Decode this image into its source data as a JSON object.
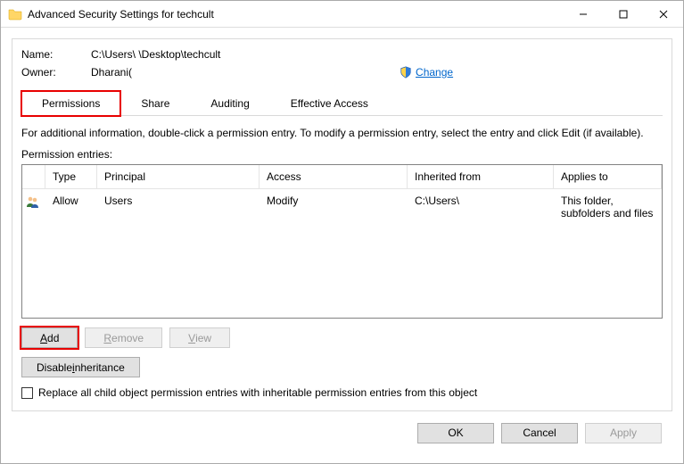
{
  "titlebar": {
    "title": "Advanced Security Settings for techcult"
  },
  "info": {
    "name_label": "Name:",
    "name_value": "C:\\Users\\                              \\Desktop\\techcult",
    "owner_label": "Owner:",
    "owner_value": "Dharani(",
    "change_label": "Change"
  },
  "tabs": {
    "permissions": "Permissions",
    "share": "Share",
    "auditing": "Auditing",
    "effective": "Effective Access"
  },
  "description": "For additional information, double-click a permission entry. To modify a permission entry, select the entry and click Edit (if available).",
  "subhead": "Permission entries:",
  "columns": {
    "type": "Type",
    "principal": "Principal",
    "access": "Access",
    "inherited": "Inherited from",
    "applies": "Applies to"
  },
  "row": {
    "type": "Allow",
    "principal": "Users",
    "access": "Modify",
    "inherited": "C:\\Users\\",
    "applies": "This folder, subfolders and files"
  },
  "buttons": {
    "add": "dd",
    "add_u": "A",
    "remove": "emove",
    "remove_u": "R",
    "view": "iew",
    "view_u": "V",
    "disable": "Disable ",
    "disable_u": "i",
    "disable2": "nheritance"
  },
  "checkbox": {
    "label": "Replace all child object permission entries with inheritable permission entries from this object"
  },
  "footer": {
    "ok": "OK",
    "cancel": "Cancel",
    "apply": "Apply"
  }
}
